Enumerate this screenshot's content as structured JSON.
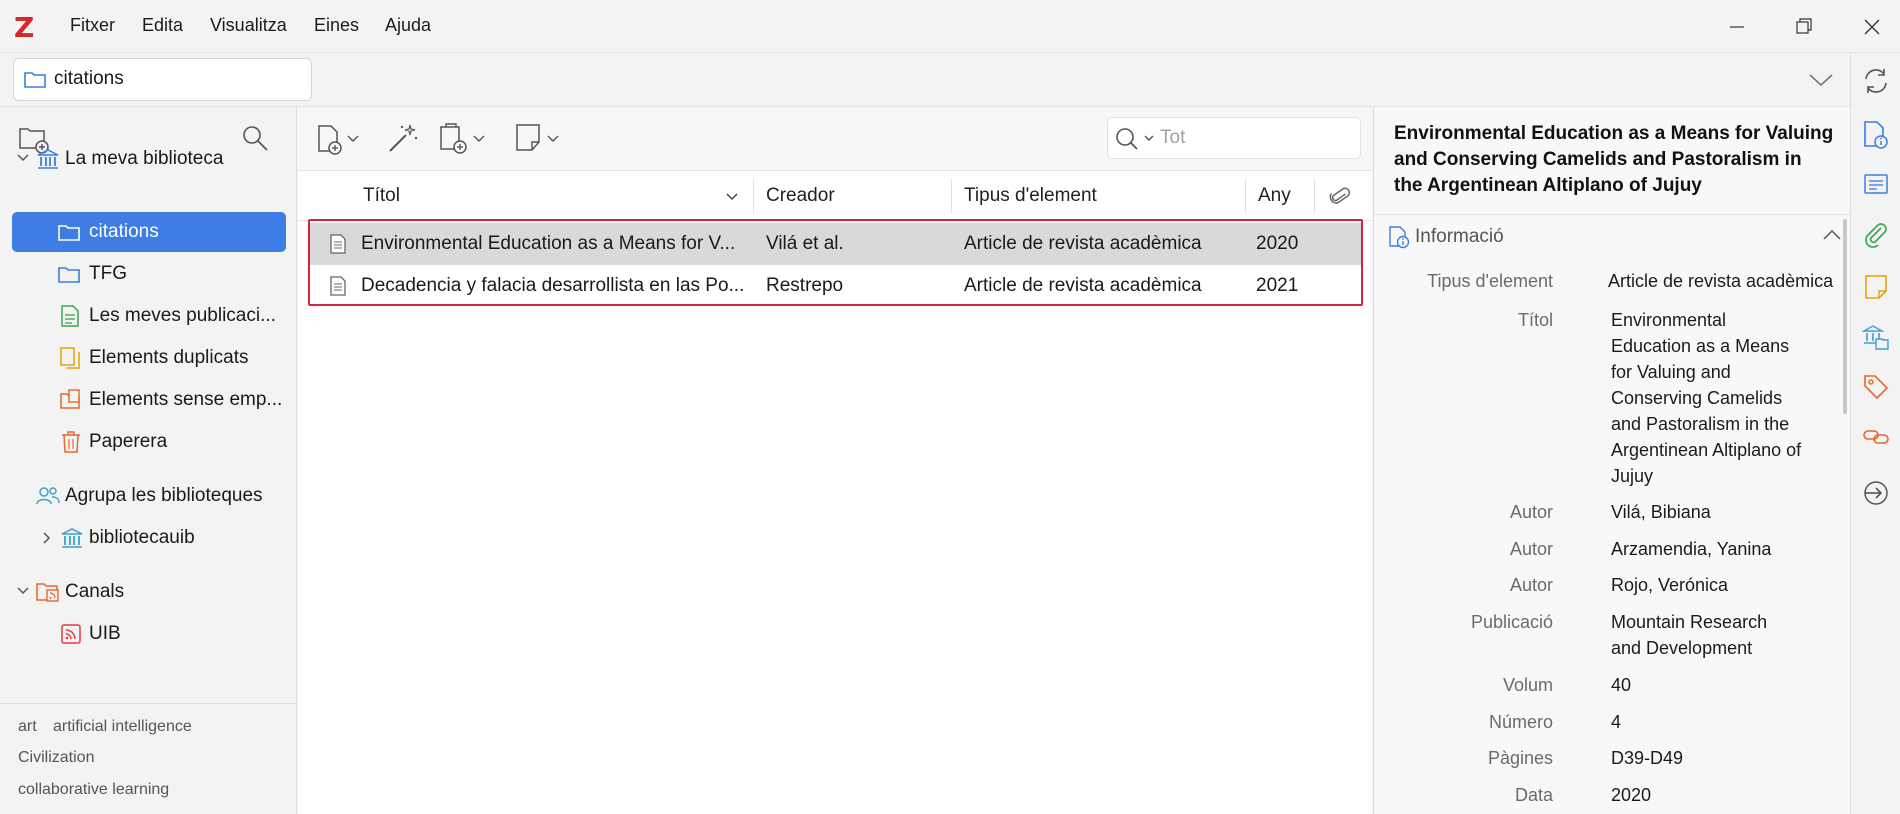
{
  "app": {
    "logo": "Z"
  },
  "menu": [
    "Fitxer",
    "Edita",
    "Visualitza",
    "Eines",
    "Ajuda"
  ],
  "tab": {
    "label": "citations"
  },
  "sidebar": {
    "library": "La meva biblioteca",
    "items": [
      {
        "label": "citations"
      },
      {
        "label": "TFG"
      },
      {
        "label": "Les meves publicaci..."
      },
      {
        "label": "Elements duplicats"
      },
      {
        "label": "Elements sense emp..."
      },
      {
        "label": "Paperera"
      }
    ],
    "group_libraries": "Agrupa les biblioteques",
    "group_item": "bibliotecauib",
    "feeds": "Canals",
    "feed_item": "UIB"
  },
  "tags": [
    "art",
    "artificial intelligence",
    "Civilization",
    "collaborative learning"
  ],
  "search": {
    "placeholder": "Tot"
  },
  "columns": {
    "title": "Títol",
    "creator": "Creador",
    "type": "Tipus d'element",
    "year": "Any"
  },
  "rows": [
    {
      "title": "Environmental Education as a Means for V...",
      "creator": "Vilá et al.",
      "type": "Article de revista acadèmica",
      "year": "2020"
    },
    {
      "title": "Decadencia y falacia desarrollista en las Po...",
      "creator": "Restrepo",
      "type": "Article de revista acadèmica",
      "year": "2021"
    }
  ],
  "detail": {
    "title": "Environmental Education as a Means for Valuing and Conserving Camelids and Pastoralism in the Argentinean Altiplano of Jujuy",
    "section": "Informació",
    "fields": {
      "type_label": "Tipus d'element",
      "type_value": "Article de revista acadèmica",
      "title_label": "Títol",
      "title_value": "Environmental Education as a Means for Valuing and Conserving Camelids and Pastoralism in the Argentinean Altiplano of Jujuy",
      "author_label": "Autor",
      "author1": "Vilá, Bibiana",
      "author2": "Arzamendia, Yanina",
      "author3": "Rojo, Verónica",
      "pub_label": "Publicació",
      "pub_value": "Mountain Research and Development",
      "vol_label": "Volum",
      "vol_value": "40",
      "num_label": "Número",
      "num_value": "4",
      "pages_label": "Pàgines",
      "pages_value": "D39-D49",
      "date_label": "Data",
      "date_value": "2020"
    }
  },
  "colors": {
    "accent": "#3d7de4",
    "highlight_border": "#d8243a",
    "selected_row": "#d9d9d9",
    "logo": "#d6272d"
  }
}
